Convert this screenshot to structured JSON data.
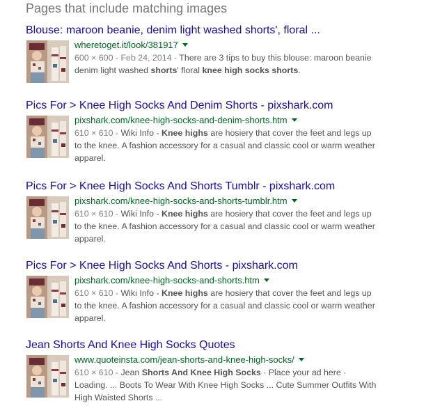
{
  "heading": "Pages that include matching images",
  "results": [
    {
      "title": "Blouse: maroon beanie, denim light washed shorts', floral ...",
      "url": "wheretoget.it/look/381917",
      "meta": "600 × 600 - Feb 24, 2014 - ",
      "snippet_parts": [
        {
          "text": "There are 3 tips to buy this blouse: maroon beanie denim light washed ",
          "bold": false
        },
        {
          "text": "shorts",
          "bold": true
        },
        {
          "text": "' floral ",
          "bold": false
        },
        {
          "text": "knee high socks shorts",
          "bold": true
        },
        {
          "text": ".",
          "bold": false
        }
      ]
    },
    {
      "title": "Pics For > Knee High Socks And Denim Shorts - pixshark.com",
      "url": "pixshark.com/knee-high-socks-and-denim-shorts.htm",
      "meta": "610 × 610 - ",
      "snippet_parts": [
        {
          "text": "Wiki Info - ",
          "bold": false
        },
        {
          "text": "Knee highs",
          "bold": true
        },
        {
          "text": " are hosiery that cover the feet and legs up to the knee. A fashion accessory for a casual and classic cool or warm weather apparel.",
          "bold": false
        }
      ]
    },
    {
      "title": "Pics For > Knee High Socks And Shorts Tumblr - pixshark.com",
      "url": "pixshark.com/knee-high-socks-and-shorts-tumblr.htm",
      "meta": "610 × 610 - ",
      "snippet_parts": [
        {
          "text": "Wiki Info - ",
          "bold": false
        },
        {
          "text": "Knee highs",
          "bold": true
        },
        {
          "text": " are hosiery that cover the feet and legs up to the knee. A fashion accessory for a casual and classic cool or warm weather apparel.",
          "bold": false
        }
      ]
    },
    {
      "title": "Pics For > Knee High Socks And Shorts - pixshark.com",
      "url": "pixshark.com/knee-high-socks-and-shorts.htm",
      "meta": "610 × 610 - ",
      "snippet_parts": [
        {
          "text": "Wiki Info - ",
          "bold": false
        },
        {
          "text": "Knee highs",
          "bold": true
        },
        {
          "text": " are hosiery that cover the feet and legs up to the knee. A fashion accessory for a casual and classic cool or warm weather apparel.",
          "bold": false
        }
      ]
    },
    {
      "title": "Jean Shorts And Knee High Socks Quotes",
      "url": "www.quoteinsta.com/jean-shorts-and-knee-high-socks/",
      "meta": "610 × 610 - ",
      "snippet_parts": [
        {
          "text": "Jean ",
          "bold": false
        },
        {
          "text": "Shorts And Knee High Socks",
          "bold": true
        },
        {
          "text": " · Place your ad here · Loading. ... Boots To Wear With Knee High Socks ... Cute Summer Outfits With High Waisted Shorts ...",
          "bold": false
        }
      ]
    }
  ],
  "colors": {
    "title_link": "#1a0dab",
    "url_green": "#006621",
    "snippet_text": "#545454",
    "heading_gray": "#777777"
  },
  "icons": {
    "url_dropdown": "caret-down-icon"
  }
}
